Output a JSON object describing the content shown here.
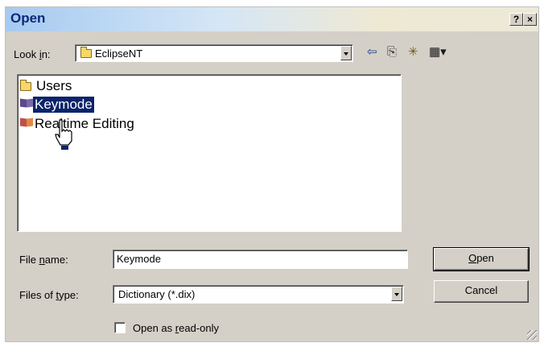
{
  "title": "Open",
  "titlebar": {
    "help": "?",
    "close": "×"
  },
  "lookin": {
    "label_pre": "Look ",
    "label_accel": "i",
    "label_post": "n:",
    "value": "EclipseNT"
  },
  "toolbar": {
    "back_icon": "⇦",
    "up_icon": "⎘",
    "newfolder_icon": "✳",
    "view_icon": "▦▾"
  },
  "files": [
    {
      "name": "Users",
      "icon": "folder-icon",
      "selected": false
    },
    {
      "name": "Keymode",
      "icon": "dictionary-icon",
      "selected": true
    },
    {
      "name": "Realtime Editing",
      "icon": "dictionary-icon",
      "selected": false
    }
  ],
  "filename": {
    "label_pre": "File ",
    "label_accel": "n",
    "label_post": "ame:",
    "value": "Keymode"
  },
  "filetype": {
    "label_pre": "Files of ",
    "label_accel": "t",
    "label_post": "ype:",
    "value": "Dictionary (*.dix)"
  },
  "buttons": {
    "open_accel": "O",
    "open_post": "pen",
    "cancel": "Cancel"
  },
  "readonly": {
    "label_pre": "Open as ",
    "label_accel": "r",
    "label_post": "ead-only",
    "checked": false
  },
  "colors": {
    "dialog_bg": "#d4d0c8",
    "selection": "#0a246a",
    "title_text": "#0b2a7a"
  }
}
